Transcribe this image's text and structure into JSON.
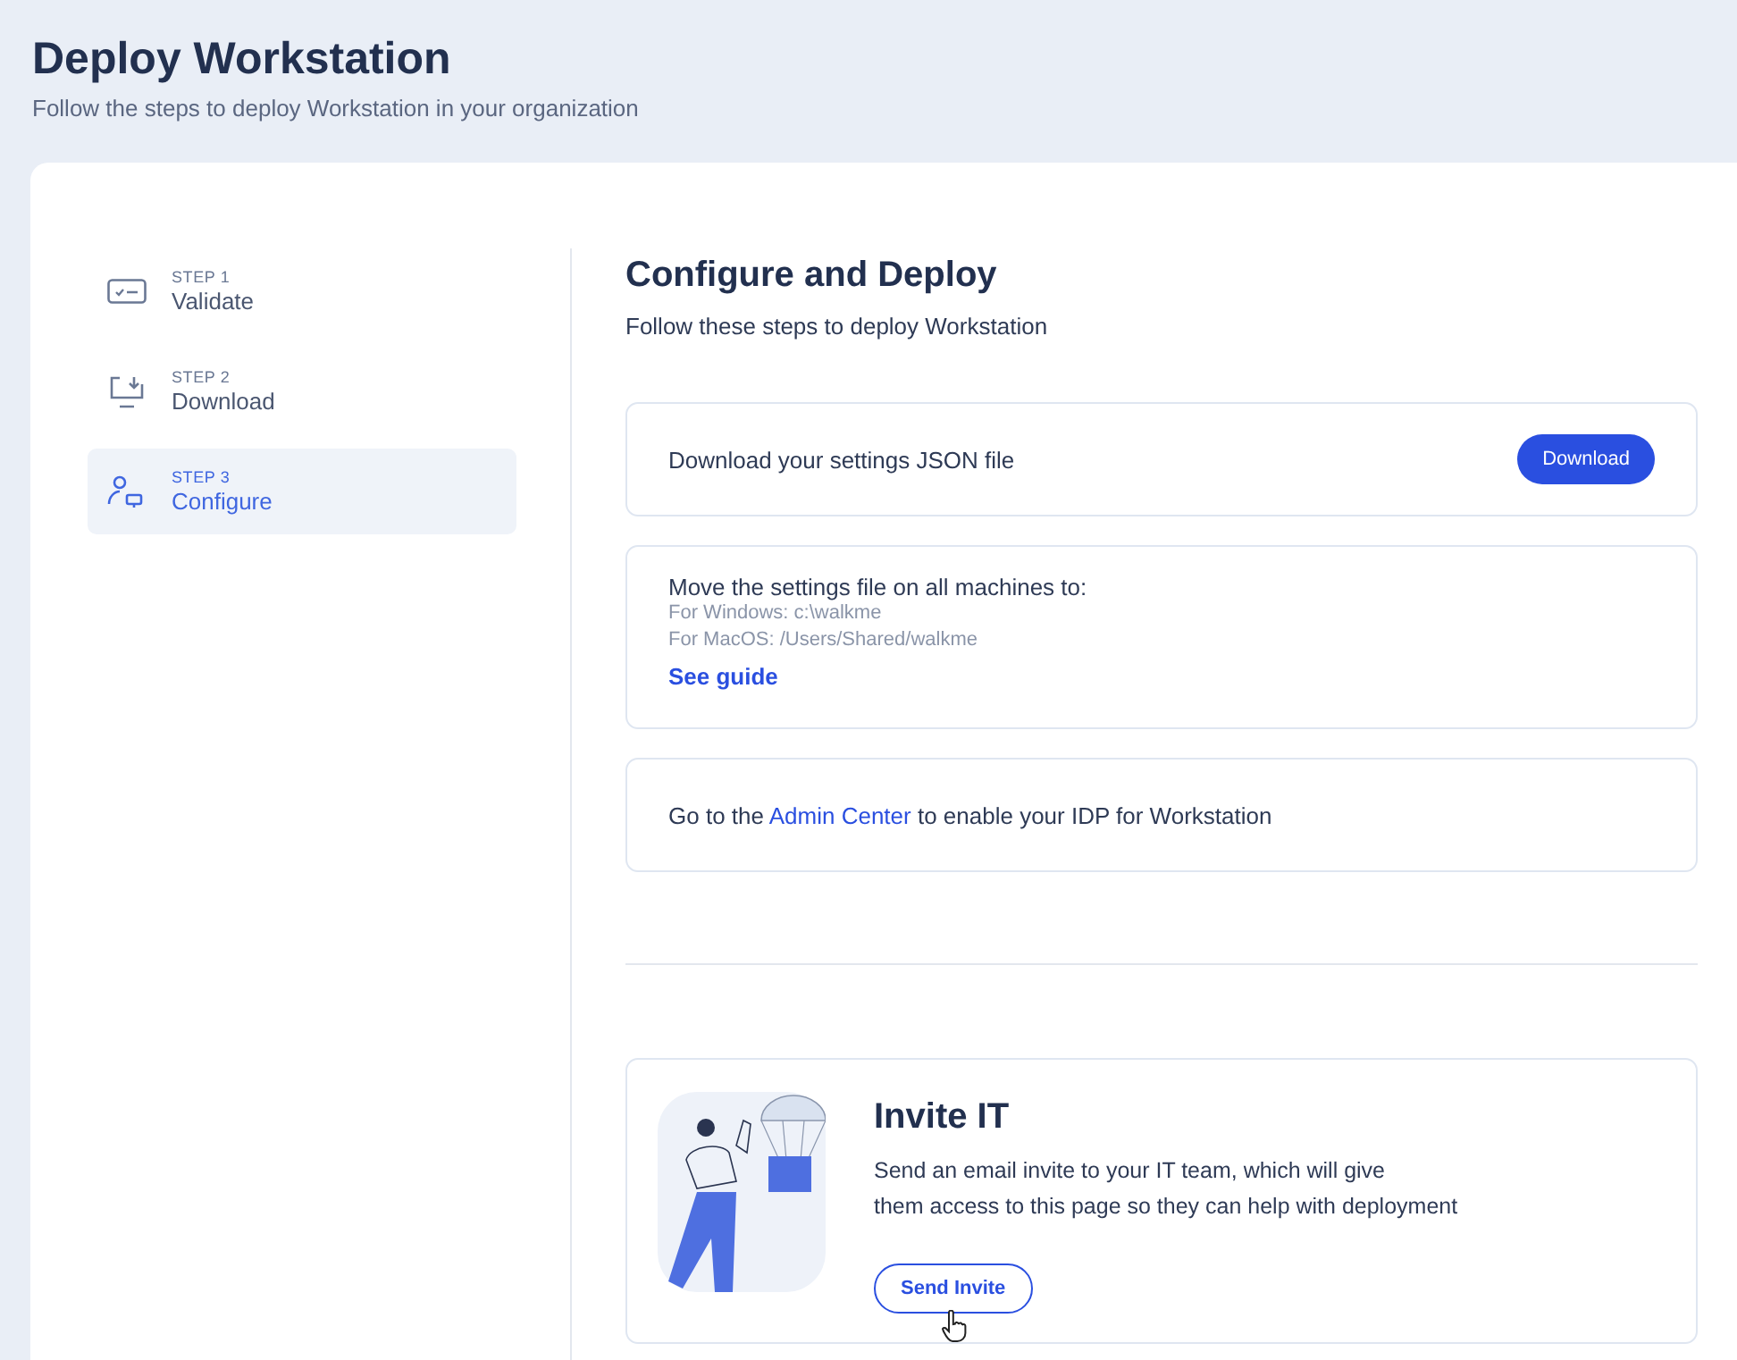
{
  "header": {
    "title": "Deploy Workstation",
    "subtitle": "Follow the steps to deploy Workstation in your organization"
  },
  "steps": [
    {
      "step": "STEP 1",
      "label": "Validate",
      "selected": false
    },
    {
      "step": "STEP 2",
      "label": "Download",
      "selected": false
    },
    {
      "step": "STEP 3",
      "label": "Configure",
      "selected": true
    }
  ],
  "section": {
    "title": "Configure and Deploy",
    "subtitle": "Follow these steps to deploy Workstation"
  },
  "download_card": {
    "text": "Download your settings JSON file",
    "button": "Download"
  },
  "move_card": {
    "text": "Move the settings file on all machines to:",
    "paths": [
      "For Windows: c:\\walkme",
      "For MacOS: /Users/Shared/walkme"
    ],
    "link": "See guide"
  },
  "admin_card": {
    "before": "Go to the ",
    "link": "Admin Center",
    "after": " to enable your IDP for Workstation"
  },
  "invite": {
    "title": "Invite IT",
    "text": "Send an email invite to your IT team, which will give\nthem access to this page so they can help with deployment",
    "button": "Send Invite"
  }
}
